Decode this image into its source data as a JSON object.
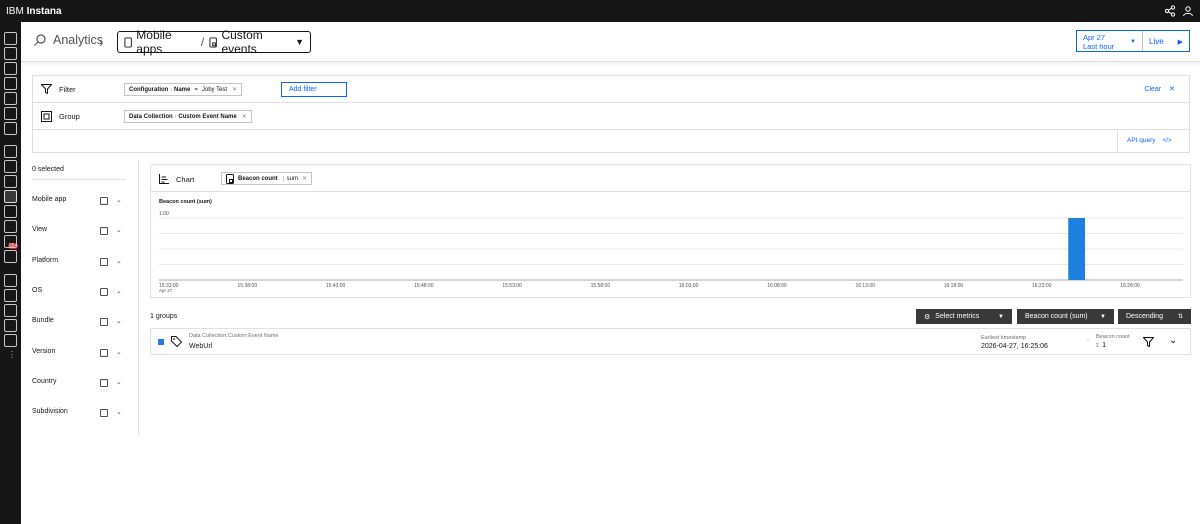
{
  "topbar": {
    "brand_prefix": "IBM",
    "brand_name": "Instana"
  },
  "nav": {
    "badge": "99+"
  },
  "header": {
    "section": "Analytics",
    "breadcrumb_app": "Mobile apps",
    "breadcrumb_sep": "/",
    "breadcrumb_current": "Custom events",
    "time_date": "Apr 27",
    "time_range": "Last hour",
    "live_label": "Live"
  },
  "filter": {
    "label": "Filter",
    "chip": {
      "key": "Configuration",
      "sub": "Name",
      "op": "=",
      "value": "Joby Test"
    },
    "add_placeholder": "Add filter",
    "clear_label": "Clear"
  },
  "group": {
    "label": "Group",
    "chip": {
      "key": "Data Collection",
      "sub": "Custom Event Name"
    }
  },
  "api_query_label": "API query",
  "sidebar": {
    "selected": "0 selected",
    "facets": [
      "Mobile app",
      "View",
      "Platform",
      "OS",
      "Bundle",
      "Version",
      "Country",
      "Subdivision"
    ]
  },
  "chart": {
    "label": "Chart",
    "metric_name": "Beacon count",
    "metric_agg": "sum"
  },
  "chart_data": {
    "type": "bar",
    "ylabel": "Beacon count (sum)",
    "ylim": [
      0,
      1
    ],
    "ytick_label": "1.00",
    "x_ticks": [
      "15:33:00",
      "15:38:00",
      "15:43:00",
      "15:48:00",
      "15:53:00",
      "15:58:00",
      "16:03:00",
      "16:08:00",
      "16:13:00",
      "16:18:00",
      "16:23:00",
      "16:28:00"
    ],
    "x_first_sublabel": "Apr 27",
    "x_range": [
      "15:33:00",
      "16:31:00"
    ],
    "series": [
      {
        "values": [
          {
            "x": "16:25:00",
            "y": 1
          }
        ]
      }
    ],
    "bar_width_minutes": 1,
    "color": "#1f7fe0"
  },
  "results": {
    "groups_count": "1 groups",
    "select_metrics": "Select metrics",
    "metric_select": "Beacon count (sum)",
    "order_select": "Descending",
    "rows": [
      {
        "label": "Data Collection.Custom Event Name",
        "value": "WebUrl",
        "ts_label": "Earliest timestamp",
        "ts_value": "2026-04-27, 16:25:06",
        "dash": "-",
        "count_label": "Beacon count",
        "count_sigma": "Σ",
        "count_value": "1"
      }
    ]
  }
}
